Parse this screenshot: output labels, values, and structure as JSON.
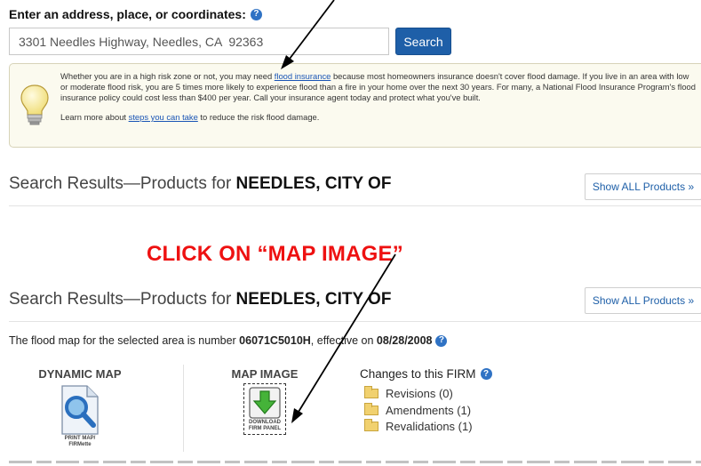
{
  "search": {
    "label": "Enter an address, place, or coordinates:",
    "value": "3301 Needles Highway, Needles, CA  92363",
    "button": "Search"
  },
  "info": {
    "line1_pre": "Whether you are in a high risk zone or not, you may need ",
    "link1": "flood insurance",
    "line1_post": " because most homeowners insurance doesn't cover flood damage. If you live in an area with low or moderate flood risk, you are 5 times more likely to experience flood than a fire in your home over the next 30 years. For many, a National Flood Insurance Program's flood insurance policy could cost less than $400 per year. Call your insurance agent today and protect what you've built.",
    "line2_pre": "Learn more about ",
    "link2": "steps you can take",
    "line2_post": " to reduce the risk flood damage."
  },
  "results": {
    "prefix": "Search Results—Products for ",
    "community": "NEEDLES, CITY OF",
    "show_all": "Show ALL Products »"
  },
  "callout": "CLICK ON “MAP IMAGE”",
  "flood_map": {
    "pre": "The flood map for the selected area is number ",
    "number": "06071C5010H",
    "mid": ", effective on ",
    "date": "08/28/2008"
  },
  "products": {
    "dynamic_title": "DYNAMIC MAP",
    "dynamic_caption1": "PRINT MAP/",
    "dynamic_caption2": "FIRMette",
    "image_title": "MAP IMAGE",
    "image_caption1": "DOWNLOAD",
    "image_caption2": "FIRM PANEL"
  },
  "changes": {
    "title": "Changes to this FIRM",
    "items": [
      "Revisions (0)",
      "Amendments (1)",
      "Revalidations (1)"
    ]
  },
  "colors": {
    "accent_blue": "#1e5fa8",
    "callout_red": "#ee1111",
    "info_bg": "#fbfaef"
  }
}
